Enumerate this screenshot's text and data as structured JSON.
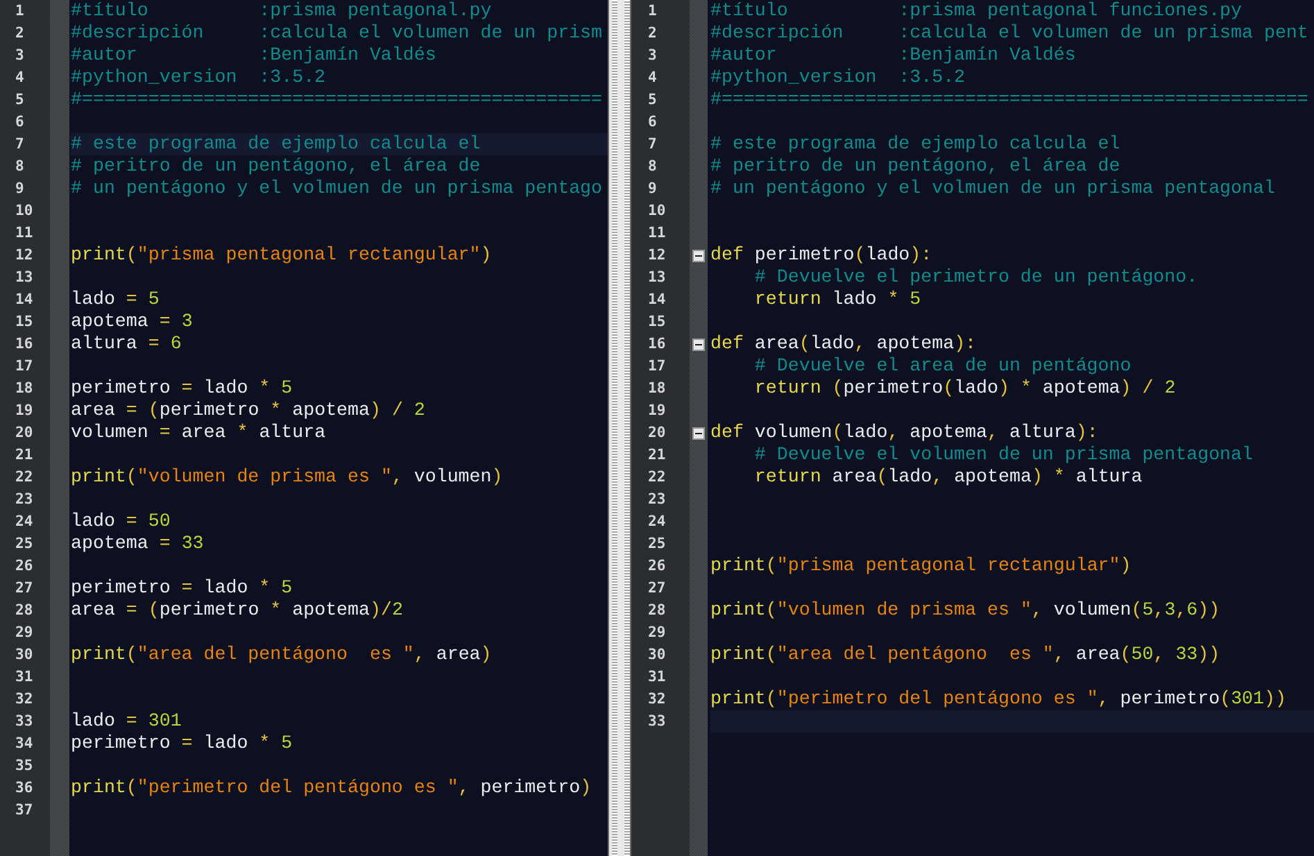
{
  "panes": [
    {
      "lines": [
        {
          "n": "1",
          "current": false,
          "tokens": [
            {
              "kind": "comment",
              "text": "#título          :prisma pentagonal.py"
            }
          ]
        },
        {
          "n": "2",
          "current": false,
          "tokens": [
            {
              "kind": "comment",
              "text": "#descripción     :calcula el volumen de un prism"
            }
          ]
        },
        {
          "n": "3",
          "current": false,
          "tokens": [
            {
              "kind": "comment",
              "text": "#autor           :Benjamín Valdés"
            }
          ]
        },
        {
          "n": "4",
          "current": false,
          "tokens": [
            {
              "kind": "comment",
              "text": "#python_version  :3.5.2"
            }
          ]
        },
        {
          "n": "5",
          "current": false,
          "tokens": [
            {
              "kind": "comment",
              "text": "#==============================================="
            }
          ]
        },
        {
          "n": "6",
          "current": false
        },
        {
          "n": "7",
          "current": true,
          "tokens": [
            {
              "kind": "comment",
              "text": "# este programa de ejemplo calcula el"
            }
          ]
        },
        {
          "n": "8",
          "current": false,
          "tokens": [
            {
              "kind": "comment",
              "text": "# peritro de un pentágono, el área de"
            }
          ]
        },
        {
          "n": "9",
          "current": false,
          "tokens": [
            {
              "kind": "comment",
              "text": "# un pentágono y el volmuen de un prisma pentago"
            }
          ]
        },
        {
          "n": "10",
          "current": false
        },
        {
          "n": "11",
          "current": false
        },
        {
          "n": "12",
          "current": false,
          "tokens": [
            {
              "kind": "keyword",
              "text": "print"
            },
            {
              "kind": "operator",
              "text": "("
            },
            {
              "kind": "string",
              "text": "\"prisma pentagonal rectangular\""
            },
            {
              "kind": "operator",
              "text": ")"
            }
          ]
        },
        {
          "n": "13",
          "current": false
        },
        {
          "n": "14",
          "current": false,
          "tokens": [
            {
              "kind": "name",
              "text": "lado "
            },
            {
              "kind": "operator",
              "text": "= "
            },
            {
              "kind": "number",
              "text": "5"
            }
          ]
        },
        {
          "n": "15",
          "current": false,
          "tokens": [
            {
              "kind": "name",
              "text": "apotema "
            },
            {
              "kind": "operator",
              "text": "= "
            },
            {
              "kind": "number",
              "text": "3"
            }
          ]
        },
        {
          "n": "16",
          "current": false,
          "tokens": [
            {
              "kind": "name",
              "text": "altura "
            },
            {
              "kind": "operator",
              "text": "= "
            },
            {
              "kind": "number",
              "text": "6"
            }
          ]
        },
        {
          "n": "17",
          "current": false
        },
        {
          "n": "18",
          "current": false,
          "tokens": [
            {
              "kind": "name",
              "text": "perimetro "
            },
            {
              "kind": "operator",
              "text": "= "
            },
            {
              "kind": "name",
              "text": "lado "
            },
            {
              "kind": "operator",
              "text": "* "
            },
            {
              "kind": "number",
              "text": "5"
            }
          ]
        },
        {
          "n": "19",
          "current": false,
          "tokens": [
            {
              "kind": "name",
              "text": "area "
            },
            {
              "kind": "operator",
              "text": "= ("
            },
            {
              "kind": "name",
              "text": "perimetro "
            },
            {
              "kind": "operator",
              "text": "* "
            },
            {
              "kind": "name",
              "text": "apotema"
            },
            {
              "kind": "operator",
              "text": ") / "
            },
            {
              "kind": "number",
              "text": "2"
            }
          ]
        },
        {
          "n": "20",
          "current": false,
          "tokens": [
            {
              "kind": "name",
              "text": "volumen "
            },
            {
              "kind": "operator",
              "text": "= "
            },
            {
              "kind": "name",
              "text": "area "
            },
            {
              "kind": "operator",
              "text": "* "
            },
            {
              "kind": "name",
              "text": "altura"
            }
          ]
        },
        {
          "n": "21",
          "current": false
        },
        {
          "n": "22",
          "current": false,
          "tokens": [
            {
              "kind": "keyword",
              "text": "print"
            },
            {
              "kind": "operator",
              "text": "("
            },
            {
              "kind": "string",
              "text": "\"volumen de prisma es \""
            },
            {
              "kind": "operator",
              "text": ", "
            },
            {
              "kind": "name",
              "text": "volumen"
            },
            {
              "kind": "operator",
              "text": ")"
            }
          ]
        },
        {
          "n": "23",
          "current": false
        },
        {
          "n": "24",
          "current": false,
          "tokens": [
            {
              "kind": "name",
              "text": "lado "
            },
            {
              "kind": "operator",
              "text": "= "
            },
            {
              "kind": "number",
              "text": "50"
            }
          ]
        },
        {
          "n": "25",
          "current": false,
          "tokens": [
            {
              "kind": "name",
              "text": "apotema "
            },
            {
              "kind": "operator",
              "text": "= "
            },
            {
              "kind": "number",
              "text": "33"
            }
          ]
        },
        {
          "n": "26",
          "current": false
        },
        {
          "n": "27",
          "current": false,
          "tokens": [
            {
              "kind": "name",
              "text": "perimetro "
            },
            {
              "kind": "operator",
              "text": "= "
            },
            {
              "kind": "name",
              "text": "lado "
            },
            {
              "kind": "operator",
              "text": "* "
            },
            {
              "kind": "number",
              "text": "5"
            }
          ]
        },
        {
          "n": "28",
          "current": false,
          "tokens": [
            {
              "kind": "name",
              "text": "area "
            },
            {
              "kind": "operator",
              "text": "= ("
            },
            {
              "kind": "name",
              "text": "perimetro "
            },
            {
              "kind": "operator",
              "text": "* "
            },
            {
              "kind": "name",
              "text": "apotema"
            },
            {
              "kind": "operator",
              "text": ")/"
            },
            {
              "kind": "number",
              "text": "2"
            }
          ]
        },
        {
          "n": "29",
          "current": false
        },
        {
          "n": "30",
          "current": false,
          "tokens": [
            {
              "kind": "keyword",
              "text": "print"
            },
            {
              "kind": "operator",
              "text": "("
            },
            {
              "kind": "string",
              "text": "\"area del pentágono  es \""
            },
            {
              "kind": "operator",
              "text": ", "
            },
            {
              "kind": "name",
              "text": "area"
            },
            {
              "kind": "operator",
              "text": ")"
            }
          ]
        },
        {
          "n": "31",
          "current": false
        },
        {
          "n": "32",
          "current": false
        },
        {
          "n": "33",
          "current": false,
          "tokens": [
            {
              "kind": "name",
              "text": "lado "
            },
            {
              "kind": "operator",
              "text": "= "
            },
            {
              "kind": "number",
              "text": "301"
            }
          ]
        },
        {
          "n": "34",
          "current": false,
          "tokens": [
            {
              "kind": "name",
              "text": "perimetro "
            },
            {
              "kind": "operator",
              "text": "= "
            },
            {
              "kind": "name",
              "text": "lado "
            },
            {
              "kind": "operator",
              "text": "* "
            },
            {
              "kind": "number",
              "text": "5"
            }
          ]
        },
        {
          "n": "35",
          "current": false
        },
        {
          "n": "36",
          "current": false,
          "tokens": [
            {
              "kind": "keyword",
              "text": "print"
            },
            {
              "kind": "operator",
              "text": "("
            },
            {
              "kind": "string",
              "text": "\"perimetro del pentágono es \""
            },
            {
              "kind": "operator",
              "text": ", "
            },
            {
              "kind": "name",
              "text": "perimetro"
            },
            {
              "kind": "operator",
              "text": ")"
            }
          ]
        },
        {
          "n": "37",
          "current": false
        }
      ]
    },
    {
      "lines": [
        {
          "n": "1",
          "current": false,
          "fold": false,
          "tokens": [
            {
              "kind": "comment",
              "text": "#título          :prisma pentagonal funciones.py"
            }
          ]
        },
        {
          "n": "2",
          "current": false,
          "fold": false,
          "tokens": [
            {
              "kind": "comment",
              "text": "#descripción     :calcula el volumen de un prisma pent"
            }
          ]
        },
        {
          "n": "3",
          "current": false,
          "fold": false,
          "tokens": [
            {
              "kind": "comment",
              "text": "#autor           :Benjamín Valdés"
            }
          ]
        },
        {
          "n": "4",
          "current": false,
          "fold": false,
          "tokens": [
            {
              "kind": "comment",
              "text": "#python_version  :3.5.2"
            }
          ]
        },
        {
          "n": "5",
          "current": false,
          "fold": false,
          "tokens": [
            {
              "kind": "comment",
              "text": "#====================================================="
            }
          ]
        },
        {
          "n": "6",
          "current": false,
          "fold": false
        },
        {
          "n": "7",
          "current": false,
          "fold": false,
          "tokens": [
            {
              "kind": "comment",
              "text": "# este programa de ejemplo calcula el"
            }
          ]
        },
        {
          "n": "8",
          "current": false,
          "fold": false,
          "tokens": [
            {
              "kind": "comment",
              "text": "# peritro de un pentágono, el área de"
            }
          ]
        },
        {
          "n": "9",
          "current": false,
          "fold": false,
          "tokens": [
            {
              "kind": "comment",
              "text": "# un pentágono y el volmuen de un prisma pentagonal"
            }
          ]
        },
        {
          "n": "10",
          "current": false,
          "fold": false
        },
        {
          "n": "11",
          "current": false,
          "fold": false
        },
        {
          "n": "12",
          "current": false,
          "fold": true,
          "tokens": [
            {
              "kind": "keyword",
              "text": "def "
            },
            {
              "kind": "name",
              "text": "perimetro"
            },
            {
              "kind": "operator",
              "text": "("
            },
            {
              "kind": "name",
              "text": "lado"
            },
            {
              "kind": "operator",
              "text": "):"
            }
          ]
        },
        {
          "n": "13",
          "current": false,
          "fold": false,
          "tokens": [
            {
              "kind": "comment",
              "text": "    # Devuelve el perimetro de un pentágono."
            }
          ]
        },
        {
          "n": "14",
          "current": false,
          "fold": false,
          "tokens": [
            {
              "kind": "keyword",
              "text": "    return "
            },
            {
              "kind": "name",
              "text": "lado "
            },
            {
              "kind": "operator",
              "text": "* "
            },
            {
              "kind": "number",
              "text": "5"
            }
          ]
        },
        {
          "n": "15",
          "current": false,
          "fold": false
        },
        {
          "n": "16",
          "current": false,
          "fold": true,
          "tokens": [
            {
              "kind": "keyword",
              "text": "def "
            },
            {
              "kind": "name",
              "text": "area"
            },
            {
              "kind": "operator",
              "text": "("
            },
            {
              "kind": "name",
              "text": "lado"
            },
            {
              "kind": "operator",
              "text": ", "
            },
            {
              "kind": "name",
              "text": "apotema"
            },
            {
              "kind": "operator",
              "text": "):"
            }
          ]
        },
        {
          "n": "17",
          "current": false,
          "fold": false,
          "tokens": [
            {
              "kind": "comment",
              "text": "    # Devuelve el area de un pentágono"
            }
          ]
        },
        {
          "n": "18",
          "current": false,
          "fold": false,
          "tokens": [
            {
              "kind": "keyword",
              "text": "    return "
            },
            {
              "kind": "operator",
              "text": "("
            },
            {
              "kind": "name",
              "text": "perimetro"
            },
            {
              "kind": "operator",
              "text": "("
            },
            {
              "kind": "name",
              "text": "lado"
            },
            {
              "kind": "operator",
              "text": ") * "
            },
            {
              "kind": "name",
              "text": "apotema"
            },
            {
              "kind": "operator",
              "text": ") / "
            },
            {
              "kind": "number",
              "text": "2"
            }
          ]
        },
        {
          "n": "19",
          "current": false,
          "fold": false
        },
        {
          "n": "20",
          "current": false,
          "fold": true,
          "tokens": [
            {
              "kind": "keyword",
              "text": "def "
            },
            {
              "kind": "name",
              "text": "volumen"
            },
            {
              "kind": "operator",
              "text": "("
            },
            {
              "kind": "name",
              "text": "lado"
            },
            {
              "kind": "operator",
              "text": ", "
            },
            {
              "kind": "name",
              "text": "apotema"
            },
            {
              "kind": "operator",
              "text": ", "
            },
            {
              "kind": "name",
              "text": "altura"
            },
            {
              "kind": "operator",
              "text": "):"
            }
          ]
        },
        {
          "n": "21",
          "current": false,
          "fold": false,
          "tokens": [
            {
              "kind": "comment",
              "text": "    # Devuelve el volumen de un prisma pentagonal"
            }
          ]
        },
        {
          "n": "22",
          "current": false,
          "fold": false,
          "tokens": [
            {
              "kind": "keyword",
              "text": "    return "
            },
            {
              "kind": "name",
              "text": "area"
            },
            {
              "kind": "operator",
              "text": "("
            },
            {
              "kind": "name",
              "text": "lado"
            },
            {
              "kind": "operator",
              "text": ", "
            },
            {
              "kind": "name",
              "text": "apotema"
            },
            {
              "kind": "operator",
              "text": ") * "
            },
            {
              "kind": "name",
              "text": "altura"
            }
          ]
        },
        {
          "n": "23",
          "current": false,
          "fold": false
        },
        {
          "n": "24",
          "current": false,
          "fold": false
        },
        {
          "n": "25",
          "current": false,
          "fold": false
        },
        {
          "n": "26",
          "current": false,
          "fold": false,
          "tokens": [
            {
              "kind": "keyword",
              "text": "print"
            },
            {
              "kind": "operator",
              "text": "("
            },
            {
              "kind": "string",
              "text": "\"prisma pentagonal rectangular\""
            },
            {
              "kind": "operator",
              "text": ")"
            }
          ]
        },
        {
          "n": "27",
          "current": false,
          "fold": false
        },
        {
          "n": "28",
          "current": false,
          "fold": false,
          "tokens": [
            {
              "kind": "keyword",
              "text": "print"
            },
            {
              "kind": "operator",
              "text": "("
            },
            {
              "kind": "string",
              "text": "\"volumen de prisma es \""
            },
            {
              "kind": "operator",
              "text": ", "
            },
            {
              "kind": "name",
              "text": "volumen"
            },
            {
              "kind": "operator",
              "text": "("
            },
            {
              "kind": "number",
              "text": "5"
            },
            {
              "kind": "operator",
              "text": ","
            },
            {
              "kind": "number",
              "text": "3"
            },
            {
              "kind": "operator",
              "text": ","
            },
            {
              "kind": "number",
              "text": "6"
            },
            {
              "kind": "operator",
              "text": "))"
            }
          ]
        },
        {
          "n": "29",
          "current": false,
          "fold": false
        },
        {
          "n": "30",
          "current": false,
          "fold": false,
          "tokens": [
            {
              "kind": "keyword",
              "text": "print"
            },
            {
              "kind": "operator",
              "text": "("
            },
            {
              "kind": "string",
              "text": "\"area del pentágono  es \""
            },
            {
              "kind": "operator",
              "text": ", "
            },
            {
              "kind": "name",
              "text": "area"
            },
            {
              "kind": "operator",
              "text": "("
            },
            {
              "kind": "number",
              "text": "50"
            },
            {
              "kind": "operator",
              "text": ", "
            },
            {
              "kind": "number",
              "text": "33"
            },
            {
              "kind": "operator",
              "text": "))"
            }
          ]
        },
        {
          "n": "31",
          "current": false,
          "fold": false
        },
        {
          "n": "32",
          "current": false,
          "fold": false,
          "tokens": [
            {
              "kind": "keyword",
              "text": "print"
            },
            {
              "kind": "operator",
              "text": "("
            },
            {
              "kind": "string",
              "text": "\"perimetro del pentágono es \""
            },
            {
              "kind": "operator",
              "text": ", "
            },
            {
              "kind": "name",
              "text": "perimetro"
            },
            {
              "kind": "operator",
              "text": "("
            },
            {
              "kind": "number",
              "text": "301"
            },
            {
              "kind": "operator",
              "text": "))"
            }
          ]
        },
        {
          "n": "33",
          "current": true,
          "fold": false
        }
      ]
    }
  ]
}
